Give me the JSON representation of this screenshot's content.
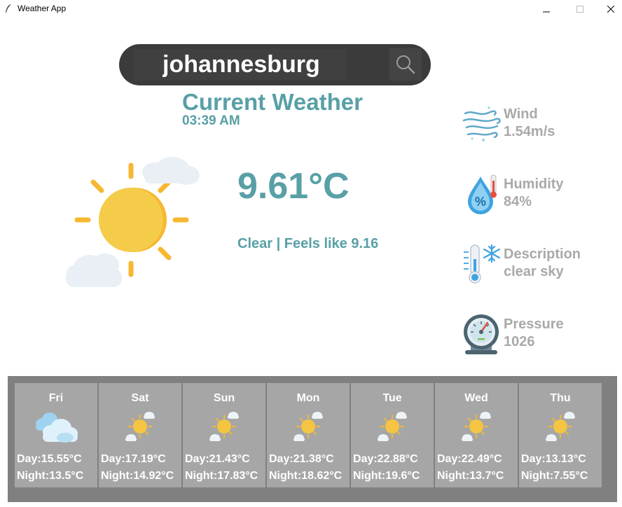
{
  "window": {
    "title": "Weather App"
  },
  "search": {
    "value": "johannesburg",
    "icon": "search-icon"
  },
  "current": {
    "heading": "Current Weather",
    "time": "03:39 AM",
    "temperature": "9.61°C",
    "condition": "Clear | Feels like 9.16",
    "icon": "sun-clouds-icon"
  },
  "stats": [
    {
      "label": "Wind",
      "value": "1.54m/s",
      "icon": "wind-icon"
    },
    {
      "label": "Humidity",
      "value": "84%",
      "icon": "humidity-icon"
    },
    {
      "label": "Description",
      "value": "clear sky",
      "icon": "thermometer-snowflake-icon"
    },
    {
      "label": "Pressure",
      "value": "1026",
      "icon": "barometer-icon"
    }
  ],
  "forecast": [
    {
      "day": "Fri",
      "day_temp": "Day:15.55°C",
      "night_temp": "Night:13.5°C",
      "icon": "cloudy-icon"
    },
    {
      "day": "Sat",
      "day_temp": "Day:17.19°C",
      "night_temp": "Night:14.92°C",
      "icon": "sun-clouds-icon"
    },
    {
      "day": "Sun",
      "day_temp": "Day:21.43°C",
      "night_temp": "Night:17.83°C",
      "icon": "sun-clouds-icon"
    },
    {
      "day": "Mon",
      "day_temp": "Day:21.38°C",
      "night_temp": "Night:18.62°C",
      "icon": "sun-clouds-icon"
    },
    {
      "day": "Tue",
      "day_temp": "Day:22.88°C",
      "night_temp": "Night:19.6°C",
      "icon": "sun-clouds-icon"
    },
    {
      "day": "Wed",
      "day_temp": "Day:22.49°C",
      "night_temp": "Night:13.7°C",
      "icon": "sun-clouds-icon"
    },
    {
      "day": "Thu",
      "day_temp": "Day:13.13°C",
      "night_temp": "Night:7.55°C",
      "icon": "sun-clouds-icon"
    }
  ],
  "colors": {
    "accent": "#58a0a6",
    "stat_text": "#a9a9a9",
    "search_bg": "#3b3b3b",
    "forecast_bg": "#808080",
    "card_bg": "#a6a6a6"
  }
}
